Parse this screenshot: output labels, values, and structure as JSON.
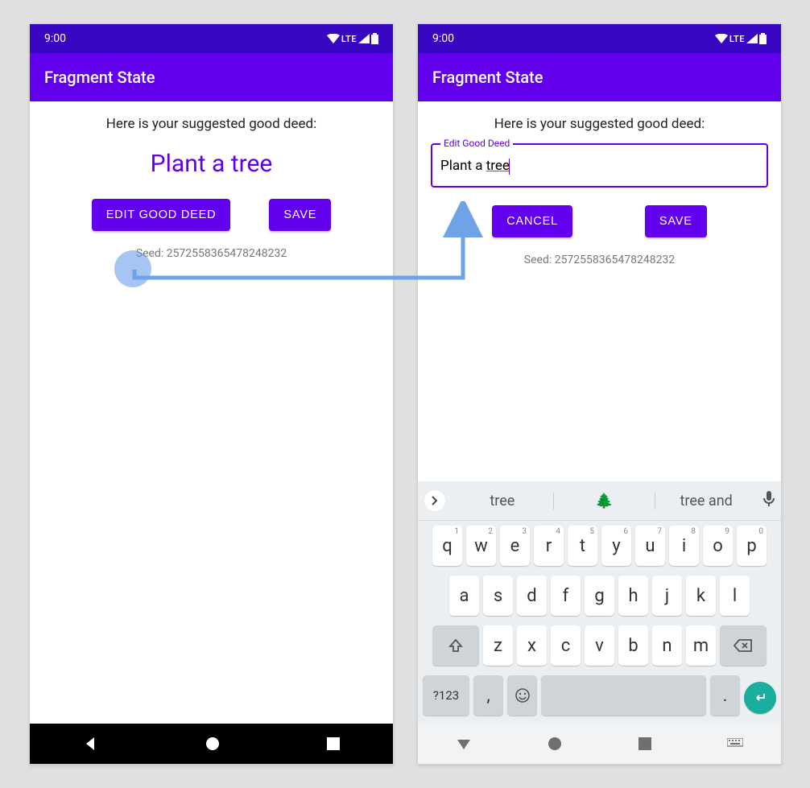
{
  "status": {
    "time": "9:00",
    "network": "LTE"
  },
  "appbar": {
    "title": "Fragment State"
  },
  "left": {
    "prompt": "Here is your suggested good deed:",
    "deed": "Plant a tree",
    "edit_btn": "EDIT GOOD DEED",
    "save_btn": "SAVE",
    "seed": "Seed: 2572558365478248232"
  },
  "right": {
    "prompt": "Here is your suggested good deed:",
    "field_label": "Edit Good Deed",
    "field_prefix": "Plant a ",
    "field_underlined": "tree",
    "cancel_btn": "CANCEL",
    "save_btn": "SAVE",
    "seed": "Seed: 2572558365478248232"
  },
  "keyboard": {
    "suggestions": [
      "tree",
      "🌲",
      "tree and"
    ],
    "row1": [
      {
        "k": "q",
        "n": "1"
      },
      {
        "k": "w",
        "n": "2"
      },
      {
        "k": "e",
        "n": "3"
      },
      {
        "k": "r",
        "n": "4"
      },
      {
        "k": "t",
        "n": "5"
      },
      {
        "k": "y",
        "n": "6"
      },
      {
        "k": "u",
        "n": "7"
      },
      {
        "k": "i",
        "n": "8"
      },
      {
        "k": "o",
        "n": "9"
      },
      {
        "k": "p",
        "n": "0"
      }
    ],
    "row2": [
      "a",
      "s",
      "d",
      "f",
      "g",
      "h",
      "j",
      "k",
      "l"
    ],
    "row3": [
      "z",
      "x",
      "c",
      "v",
      "b",
      "n",
      "m"
    ],
    "sym": "?123",
    "comma": ",",
    "period": "."
  }
}
